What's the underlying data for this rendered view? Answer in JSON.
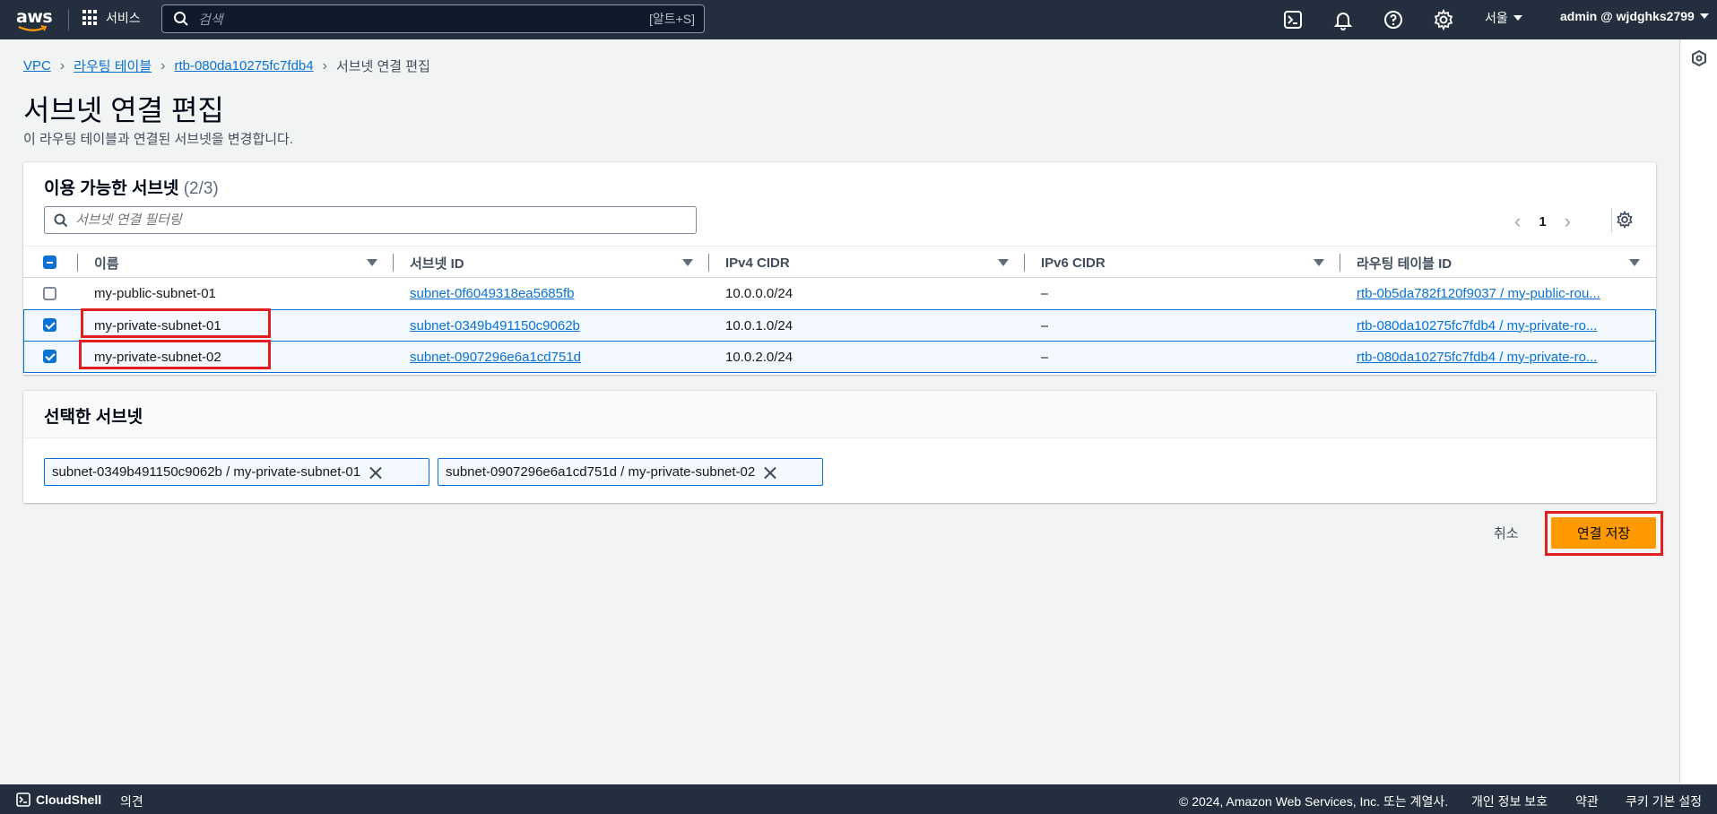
{
  "topnav": {
    "logo_text": "aws",
    "services_label": "서비스",
    "search_placeholder": "검색",
    "search_shortcut": "[알트+S]",
    "region_label": "서울",
    "account_label": "admin @ wjdghks2799"
  },
  "breadcrumb": {
    "items": [
      "VPC",
      "라우팅 테이블",
      "rtb-080da10275fc7fdb4"
    ],
    "current": "서브넷 연결 편집"
  },
  "page": {
    "title": "서브넷 연결 편집",
    "description": "이 라우팅 테이블과 연결된 서브넷을 변경합니다."
  },
  "available": {
    "header": "이용 가능한 서브넷",
    "count": "(2/3)",
    "filter_placeholder": "서브넷 연결 필터링",
    "page_number": "1",
    "columns": [
      "이름",
      "서브넷 ID",
      "IPv4 CIDR",
      "IPv6 CIDR",
      "라우팅 테이블 ID"
    ],
    "rows": [
      {
        "selected": false,
        "name": "my-public-subnet-01",
        "subnet_id": "subnet-0f6049318ea5685fb",
        "ipv4": "10.0.0.0/24",
        "ipv6": "–",
        "route_table": "rtb-0b5da782f120f9037 / my-public-rou..."
      },
      {
        "selected": true,
        "name": "my-private-subnet-01",
        "subnet_id": "subnet-0349b491150c9062b",
        "ipv4": "10.0.1.0/24",
        "ipv6": "–",
        "route_table": "rtb-080da10275fc7fdb4 / my-private-ro..."
      },
      {
        "selected": true,
        "name": "my-private-subnet-02",
        "subnet_id": "subnet-0907296e6a1cd751d",
        "ipv4": "10.0.2.0/24",
        "ipv6": "–",
        "route_table": "rtb-080da10275fc7fdb4 / my-private-ro..."
      }
    ]
  },
  "selected": {
    "header": "선택한 서브넷",
    "tokens": [
      "subnet-0349b491150c9062b / my-private-subnet-01",
      "subnet-0907296e6a1cd751d / my-private-subnet-02"
    ]
  },
  "actions": {
    "cancel_label": "취소",
    "save_label": "연결 저장"
  },
  "footer": {
    "cloudshell_label": "CloudShell",
    "feedback_label": "의견",
    "copyright": "© 2024, Amazon Web Services, Inc. 또는 계열사.",
    "privacy": "개인 정보 보호",
    "terms": "약관",
    "cookies": "쿠키 기본 설정"
  },
  "colors": {
    "nav_bg": "#232f3e",
    "link": "#0972d3",
    "primary_button": "#ff9900",
    "highlight": "#e02020"
  }
}
